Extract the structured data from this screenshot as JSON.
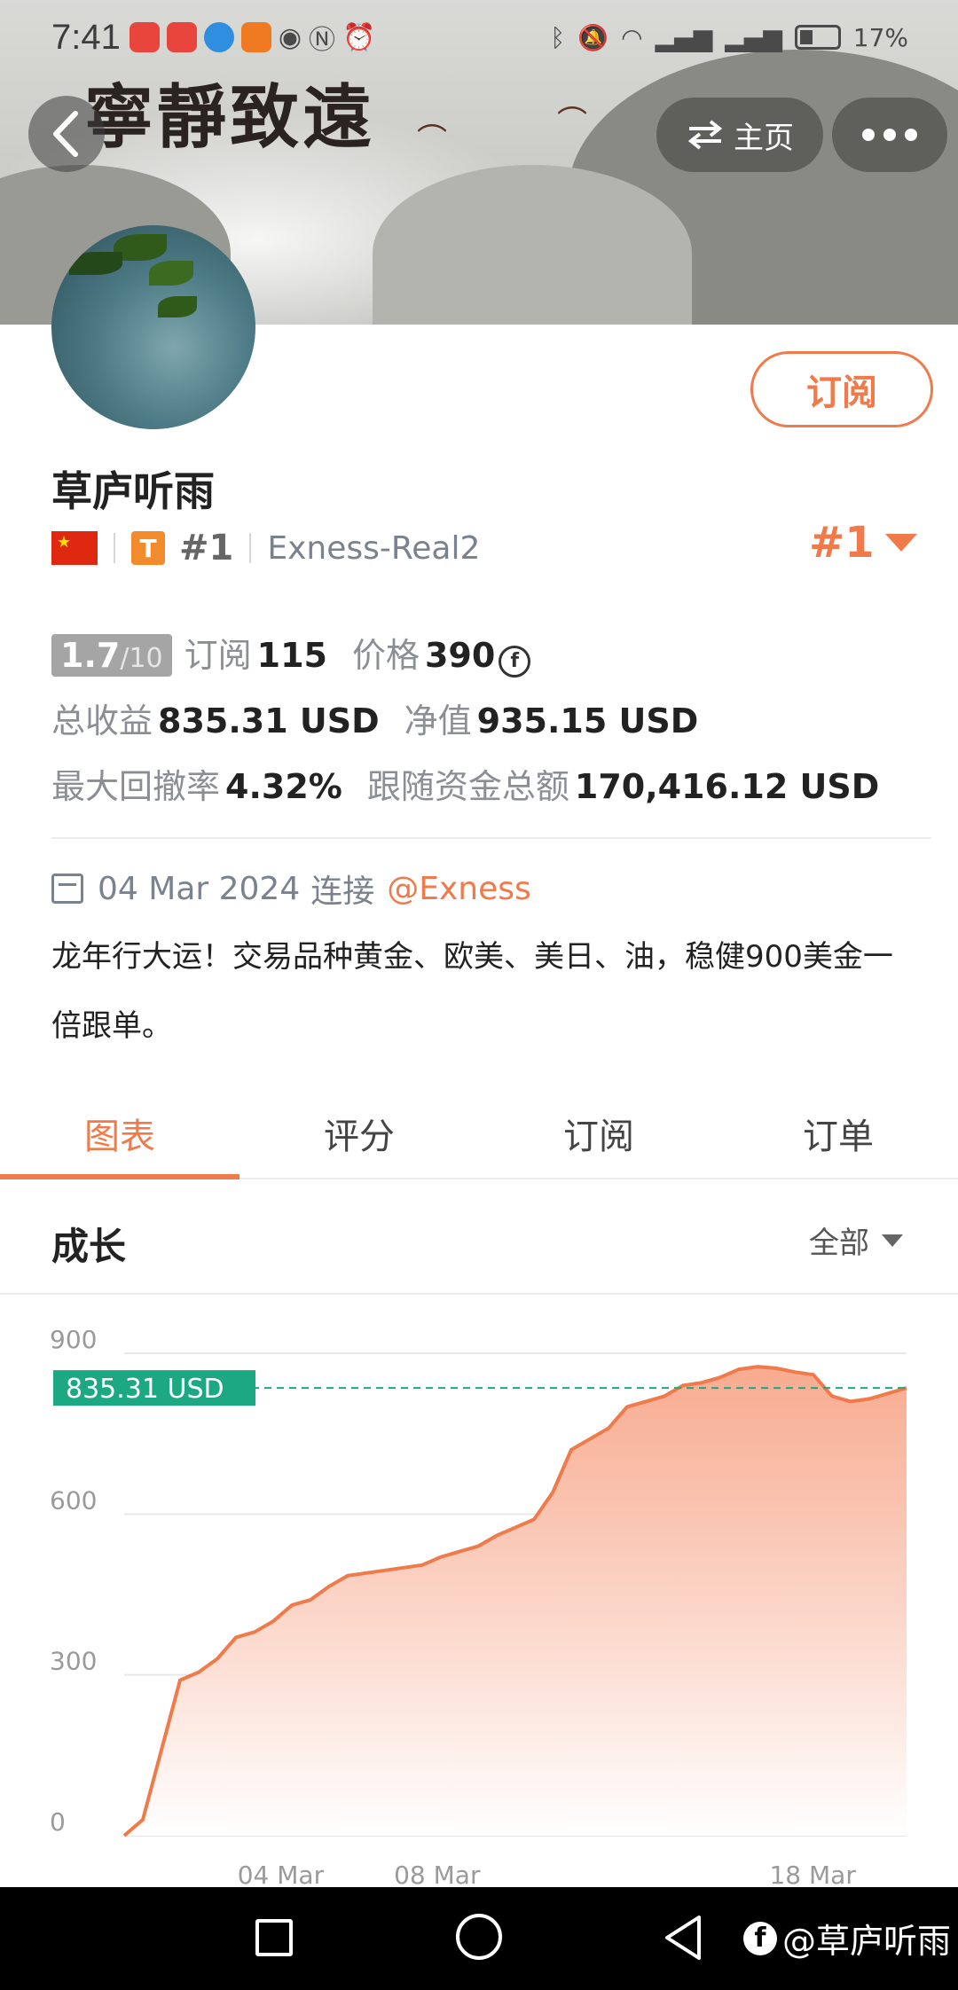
{
  "status_bar": {
    "time": "7:41",
    "battery": "17%"
  },
  "banner": {
    "calligraphy": "寧靜致遠"
  },
  "nav": {
    "home_label": "主页"
  },
  "profile": {
    "subscribe_label": "订阅",
    "name": "草庐听雨",
    "badge_letter": "T",
    "rank_small": "#1",
    "broker": "Exness-Real2",
    "rank_big": "#1"
  },
  "stats": {
    "score": "1.7",
    "score_den": "/10",
    "subscriptions_label": "订阅",
    "subscriptions_value": "115",
    "price_label": "价格",
    "price_value": "390",
    "price_coin": "f",
    "total_profit_label": "总收益",
    "total_profit_value": "835.31 USD",
    "net_value_label": "净值",
    "net_value_value": "935.15 USD",
    "max_drawdown_label": "最大回撤率",
    "max_drawdown_value": "4.32%",
    "follow_funds_label": "跟随资金总额",
    "follow_funds_value": "170,416.12 USD"
  },
  "connection": {
    "date": "04 Mar 2024",
    "connect_text": "连接",
    "broker_link": "@Exness"
  },
  "description": "龙年行大运！交易品种黄金、欧美、美日、油，稳健900美金一倍跟单。",
  "tabs": [
    {
      "label": "图表",
      "active": true
    },
    {
      "label": "评分",
      "active": false
    },
    {
      "label": "订阅",
      "active": false
    },
    {
      "label": "订单",
      "active": false
    }
  ],
  "growth": {
    "title": "成长",
    "range_label": "全部"
  },
  "chart_data": {
    "type": "area",
    "title": "",
    "xlabel": "",
    "ylabel": "",
    "ylim": [
      0,
      900
    ],
    "y_ticks": [
      "0",
      "300",
      "600",
      "900"
    ],
    "x_ticks": [
      "04 Mar",
      "08 Mar",
      "18 Mar"
    ],
    "current_value_label": "835.31 USD",
    "current_value": 835.31,
    "series": [
      {
        "values": [
          0,
          30,
          160,
          290,
          305,
          330,
          370,
          380,
          400,
          430,
          440,
          465,
          485,
          490,
          495,
          500,
          505,
          520,
          530,
          540,
          560,
          575,
          590,
          640,
          720,
          740,
          760,
          800,
          810,
          820,
          840,
          845,
          855,
          870,
          875,
          872,
          865,
          860,
          820,
          810,
          815,
          825,
          835.31
        ]
      }
    ],
    "colors": {
      "line": "#f07a4a",
      "fill_top": "#f7a78a",
      "fill_bottom": "#ffffff",
      "current_line": "#1ba883"
    }
  },
  "watermark": "@草庐听雨"
}
